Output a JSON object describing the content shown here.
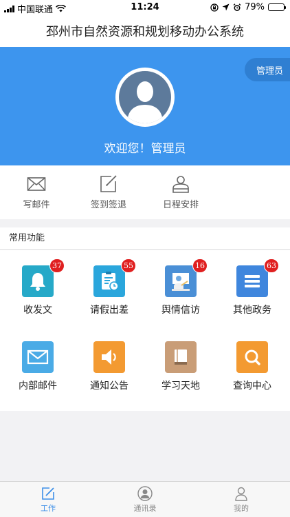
{
  "status_bar": {
    "carrier": "中国联通",
    "time": "11:24",
    "battery": "79%",
    "battery_level": 0.79,
    "icons": [
      "signal-icon",
      "wifi-icon",
      "lock-rotation-icon",
      "location-icon",
      "alarm-icon",
      "battery-icon"
    ]
  },
  "header": {
    "title": "邳州市自然资源和规划移动办公系统"
  },
  "profile": {
    "role_tag": "管理员",
    "welcome": "欢迎您！管理员",
    "avatar_icon": "user-avatar-icon"
  },
  "quick_actions": [
    {
      "label": "写邮件",
      "icon": "mail-icon"
    },
    {
      "label": "签到签退",
      "icon": "checkin-icon"
    },
    {
      "label": "日程安排",
      "icon": "schedule-person-icon"
    }
  ],
  "section": {
    "title": "常用功能"
  },
  "functions": [
    {
      "label": "收发文",
      "badge": "37",
      "icon": "bell-icon",
      "color": "#26a9c8"
    },
    {
      "label": "请假出差",
      "badge": "55",
      "icon": "leave-form-icon",
      "color": "#2aa6dc"
    },
    {
      "label": "舆情信访",
      "badge": "16",
      "icon": "speaker-podium-icon",
      "color": "#4a8fd6"
    },
    {
      "label": "其他政务",
      "badge": "63",
      "icon": "list-icon",
      "color": "#3f86dd"
    },
    {
      "label": "内部邮件",
      "badge": "",
      "icon": "envelope-icon",
      "color": "#4aabe6"
    },
    {
      "label": "通知公告",
      "badge": "",
      "icon": "speaker-icon",
      "color": "#f39a31"
    },
    {
      "label": "学习天地",
      "badge": "",
      "icon": "book-icon",
      "color": "#c99d77"
    },
    {
      "label": "查询中心",
      "badge": "",
      "icon": "search-icon",
      "color": "#f39a31"
    }
  ],
  "tab_bar": {
    "tabs": [
      {
        "label": "工作",
        "icon": "edit-icon",
        "active": true
      },
      {
        "label": "通讯录",
        "icon": "contacts-icon",
        "active": false
      },
      {
        "label": "我的",
        "icon": "person-icon",
        "active": false
      }
    ],
    "active_color": "#3d8fe8"
  }
}
